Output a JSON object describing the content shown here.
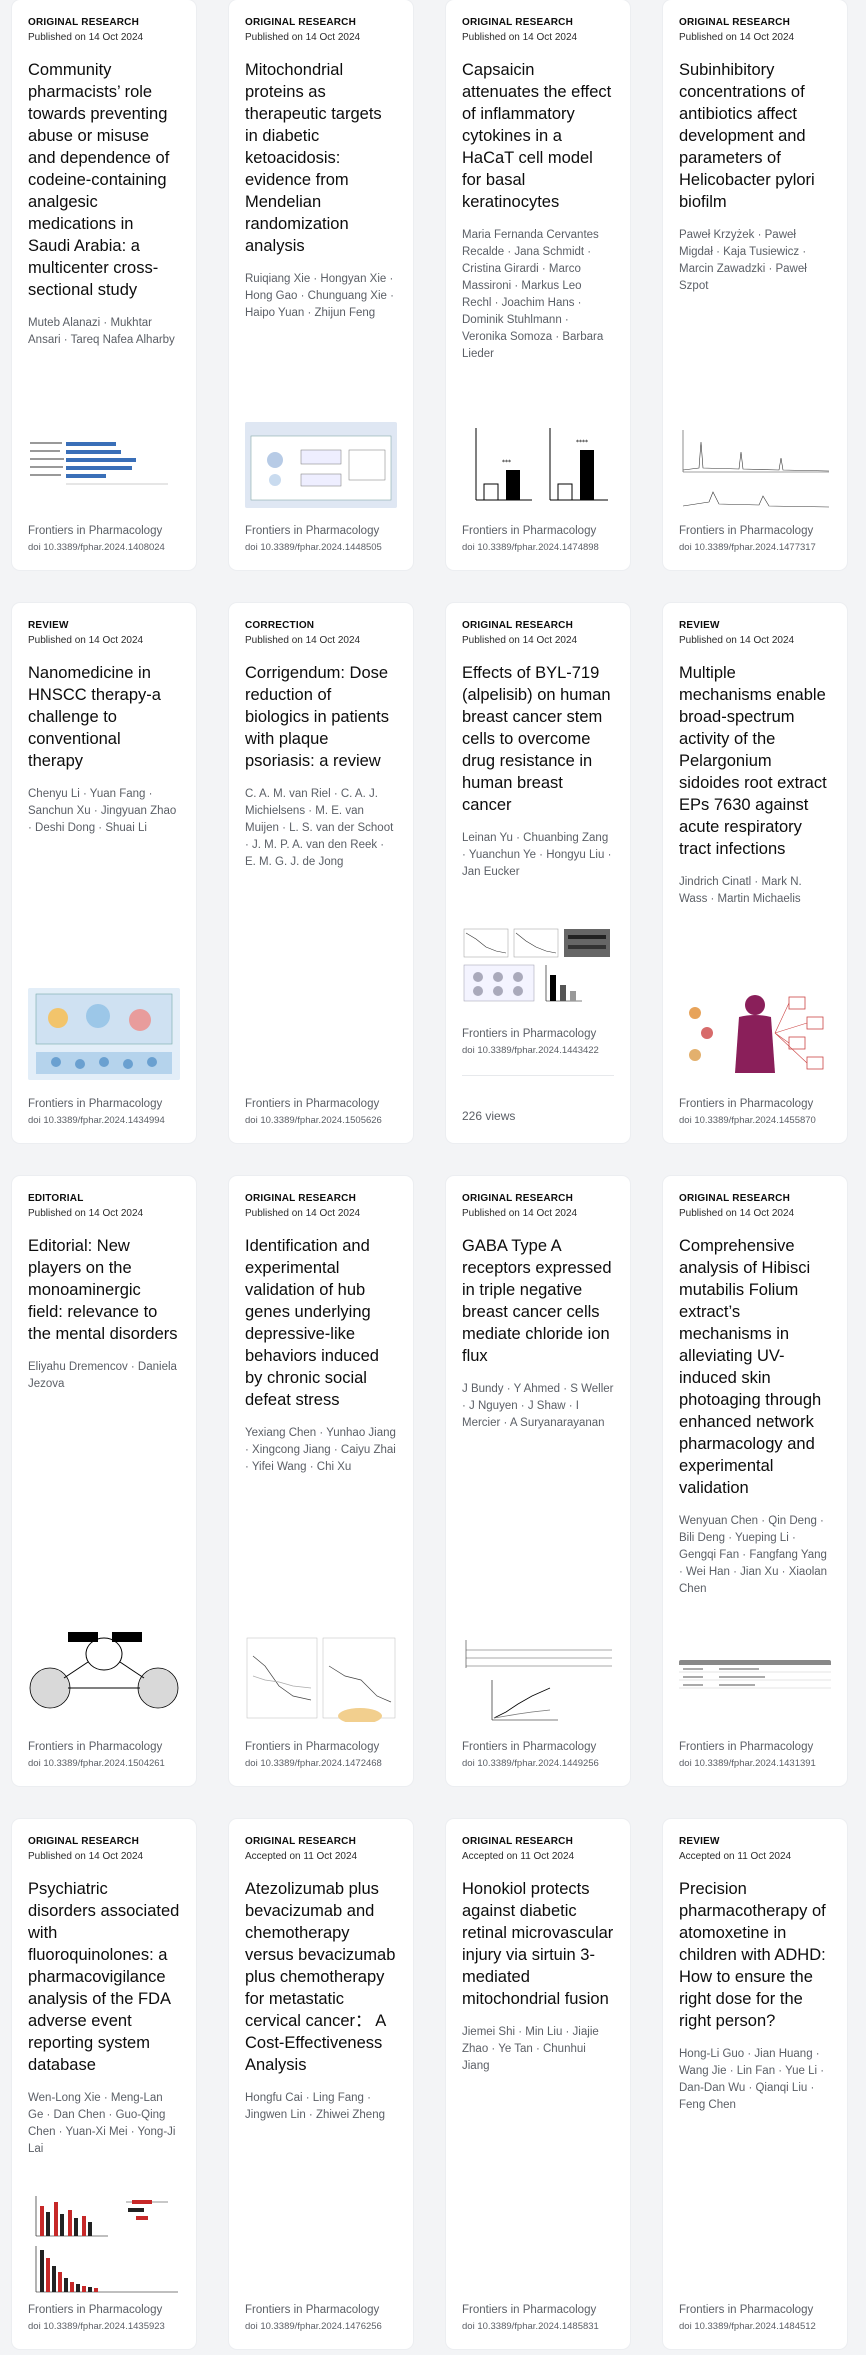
{
  "cards": [
    {
      "type": "ORIGINAL RESEARCH",
      "date": "Published on 14 Oct 2024",
      "title": "Community pharmacists’ role towards preventing abuse or misuse and dependence of codeine-containing analgesic medications in Saudi Arabia: a multicenter cross-sectional study",
      "authors": "Muteb Alanazi · Mukhtar Ansari · Tareq Nafea Alharby",
      "journal": "Frontiers in Pharmacology",
      "doi": "doi 10.3389/fphar.2024.1408024"
    },
    {
      "type": "ORIGINAL RESEARCH",
      "date": "Published on 14 Oct 2024",
      "title": "Mitochondrial proteins as therapeutic targets in diabetic ketoacidosis: evidence from Mendelian randomization analysis",
      "authors": "Ruiqiang Xie · Hongyan Xie · Hong Gao · Chunguang Xie · Haipo Yuan · Zhijun Feng",
      "journal": "Frontiers in Pharmacology",
      "doi": "doi 10.3389/fphar.2024.1448505"
    },
    {
      "type": "ORIGINAL RESEARCH",
      "date": "Published on 14 Oct 2024",
      "title": "Capsaicin attenuates the effect of inflammatory cytokines in a HaCaT cell model for basal keratinocytes",
      "authors": "Maria Fernanda Cervantes Recalde · Jana Schmidt · Cristina Girardi · Marco Massironi · Markus Leo Rechl · Joachim Hans · Dominik Stuhlmann · Veronika Somoza · Barbara Lieder",
      "journal": "Frontiers in Pharmacology",
      "doi": "doi 10.3389/fphar.2024.1474898"
    },
    {
      "type": "ORIGINAL RESEARCH",
      "date": "Published on 14 Oct 2024",
      "title": "Subinhibitory concentrations of antibiotics affect development and parameters of Helicobacter pylori biofilm",
      "authors": "Paweł Krzyżek · Paweł Migdał · Kaja Tusiewicz · Marcin Zawadzki · Paweł Szpot",
      "journal": "Frontiers in Pharmacology",
      "doi": "doi 10.3389/fphar.2024.1477317"
    },
    {
      "type": "REVIEW",
      "date": "Published on 14 Oct 2024",
      "title": "Nanomedicine in HNSCC therapy-a challenge to conventional therapy",
      "authors": "Chenyu Li · Yuan Fang · Sanchun Xu · Jingyuan Zhao · Deshi Dong · Shuai Li",
      "journal": "Frontiers in Pharmacology",
      "doi": "doi 10.3389/fphar.2024.1434994"
    },
    {
      "type": "CORRECTION",
      "date": "Published on 14 Oct 2024",
      "title": "Corrigendum: Dose reduction of biologics in patients with plaque psoriasis: a review",
      "authors": "C. A. M. van Riel · C. A. J. Michielsens · M. E. van Muijen · L. S. van der Schoot · J. M. P. A. van den Reek · E. M. G. J. de Jong",
      "journal": "Frontiers in Pharmacology",
      "doi": "doi 10.3389/fphar.2024.1505626"
    },
    {
      "type": "ORIGINAL RESEARCH",
      "date": "Published on 14 Oct 2024",
      "title": "Effects of BYL-719 (alpelisib) on human breast cancer stem cells to overcome drug resistance in human breast cancer",
      "authors": "Leinan Yu · Chuanbing Zang · Yuanchun Ye · Hongyu Liu · Jan Eucker",
      "journal": "Frontiers in Pharmacology",
      "doi": "doi 10.3389/fphar.2024.1443422",
      "views": "226 views"
    },
    {
      "type": "REVIEW",
      "date": "Published on 14 Oct 2024",
      "title": "Multiple mechanisms enable broad-spectrum activity of the Pelargonium sidoides root extract EPs 7630 against acute respiratory tract infections",
      "authors": "Jindrich Cinatl · Mark N. Wass · Martin Michaelis",
      "journal": "Frontiers in Pharmacology",
      "doi": "doi 10.3389/fphar.2024.1455870"
    },
    {
      "type": "EDITORIAL",
      "date": "Published on 14 Oct 2024",
      "title": "Editorial: New players on the monoaminergic field: relevance to the mental disorders",
      "authors": "Eliyahu Dremencov · Daniela Jezova",
      "journal": "Frontiers in Pharmacology",
      "doi": "doi 10.3389/fphar.2024.1504261"
    },
    {
      "type": "ORIGINAL RESEARCH",
      "date": "Published on 14 Oct 2024",
      "title": "Identification and experimental validation of hub genes underlying depressive-like behaviors induced by chronic social defeat stress",
      "authors": "Yexiang Chen · Yunhao Jiang · Xingcong Jiang · Caiyu Zhai · Yifei Wang · Chi Xu",
      "journal": "Frontiers in Pharmacology",
      "doi": "doi 10.3389/fphar.2024.1472468"
    },
    {
      "type": "ORIGINAL RESEARCH",
      "date": "Published on 14 Oct 2024",
      "title": "GABA Type A receptors expressed in triple negative breast cancer cells mediate chloride ion flux",
      "authors": "J Bundy · Y Ahmed · S Weller · J Nguyen · J Shaw · I Mercier · A Suryanarayanan",
      "journal": "Frontiers in Pharmacology",
      "doi": "doi 10.3389/fphar.2024.1449256"
    },
    {
      "type": "ORIGINAL RESEARCH",
      "date": "Published on 14 Oct 2024",
      "title": "Comprehensive analysis of Hibisci mutabilis Folium extract’s mechanisms in alleviating UV-induced skin photoaging through enhanced network pharmacology and experimental validation",
      "authors": "Wenyuan Chen · Qin Deng · Bili Deng · Yueping Li · Gengqi Fan · Fangfang Yang · Wei Han · Jian Xu · Xiaolan Chen",
      "journal": "Frontiers in Pharmacology",
      "doi": "doi 10.3389/fphar.2024.1431391"
    },
    {
      "type": "ORIGINAL RESEARCH",
      "date": "Published on 14 Oct 2024",
      "title": "Psychiatric disorders associated with fluoroquinolones: a pharmacovigilance analysis of the FDA adverse event reporting system database",
      "authors": "Wen-Long Xie · Meng-Lan Ge · Dan Chen · Guo-Qing Chen · Yuan-Xi Mei · Yong-Ji Lai",
      "journal": "Frontiers in Pharmacology",
      "doi": "doi 10.3389/fphar.2024.1435923"
    },
    {
      "type": "ORIGINAL RESEARCH",
      "date": "Accepted on 11 Oct 2024",
      "title": "Atezolizumab plus bevacizumab and chemotherapy versus bevacizumab plus chemotherapy for metastatic cervical cancer： A Cost-Effectiveness Analysis",
      "authors": "Hongfu Cai · Ling Fang · Jingwen Lin · Zhiwei Zheng",
      "journal": "Frontiers in Pharmacology",
      "doi": "doi 10.3389/fphar.2024.1476256"
    },
    {
      "type": "ORIGINAL RESEARCH",
      "date": "Accepted on 11 Oct 2024",
      "title": "Honokiol protects against diabetic retinal microvascular injury via sirtuin 3-mediated mitochondrial fusion",
      "authors": "Jiemei Shi · Min Liu · Jiajie Zhao · Ye Tan · Chunhui Jiang",
      "journal": "Frontiers in Pharmacology",
      "doi": "doi 10.3389/fphar.2024.1485831"
    },
    {
      "type": "REVIEW",
      "date": "Accepted on 11 Oct 2024",
      "title": "Precision pharmacotherapy of atomoxetine in children with ADHD: How to ensure the right dose for the right person?",
      "authors": "Hong-Li Guo · Jian Huang · Wang Jie · Lin Fan · Yue Li · Dan-Dan Wu · Qianqi Liu · Feng Chen",
      "journal": "Frontiers in Pharmacology",
      "doi": "doi 10.3389/fphar.2024.1484512"
    }
  ]
}
